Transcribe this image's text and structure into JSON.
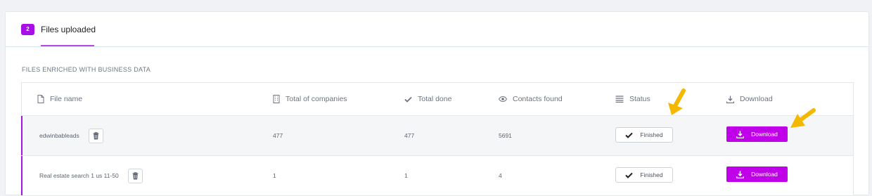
{
  "tabs": [
    {
      "badge": "2",
      "label": "Files uploaded"
    }
  ],
  "section_title": "FILES ENRICHED WITH BUSINESS DATA",
  "table": {
    "headers": {
      "file_name": "File name",
      "total_companies": "Total of companies",
      "total_done": "Total done",
      "contacts_found": "Contacts found",
      "status": "Status",
      "download": "Download"
    },
    "rows": [
      {
        "file_name": "edwinbableads",
        "total_companies": "477",
        "total_done": "477",
        "contacts_found": "5691",
        "status": "Finished",
        "download": "Download"
      },
      {
        "file_name": "Real estate search 1 us 11-50",
        "total_companies": "1",
        "total_done": "1",
        "contacts_found": "4",
        "status": "Finished",
        "download": "Download"
      }
    ]
  },
  "icons": {
    "file": "file-icon",
    "companies": "building-icon",
    "done": "check-icon",
    "contacts": "eye-icon",
    "status": "list-icon",
    "download": "download-icon",
    "delete": "trash-icon",
    "annotation": "arrow-annotation-icon"
  },
  "colors": {
    "accent": "#c000e8",
    "badge": "#a80fe6",
    "annotation_arrow": "#f5b800"
  }
}
